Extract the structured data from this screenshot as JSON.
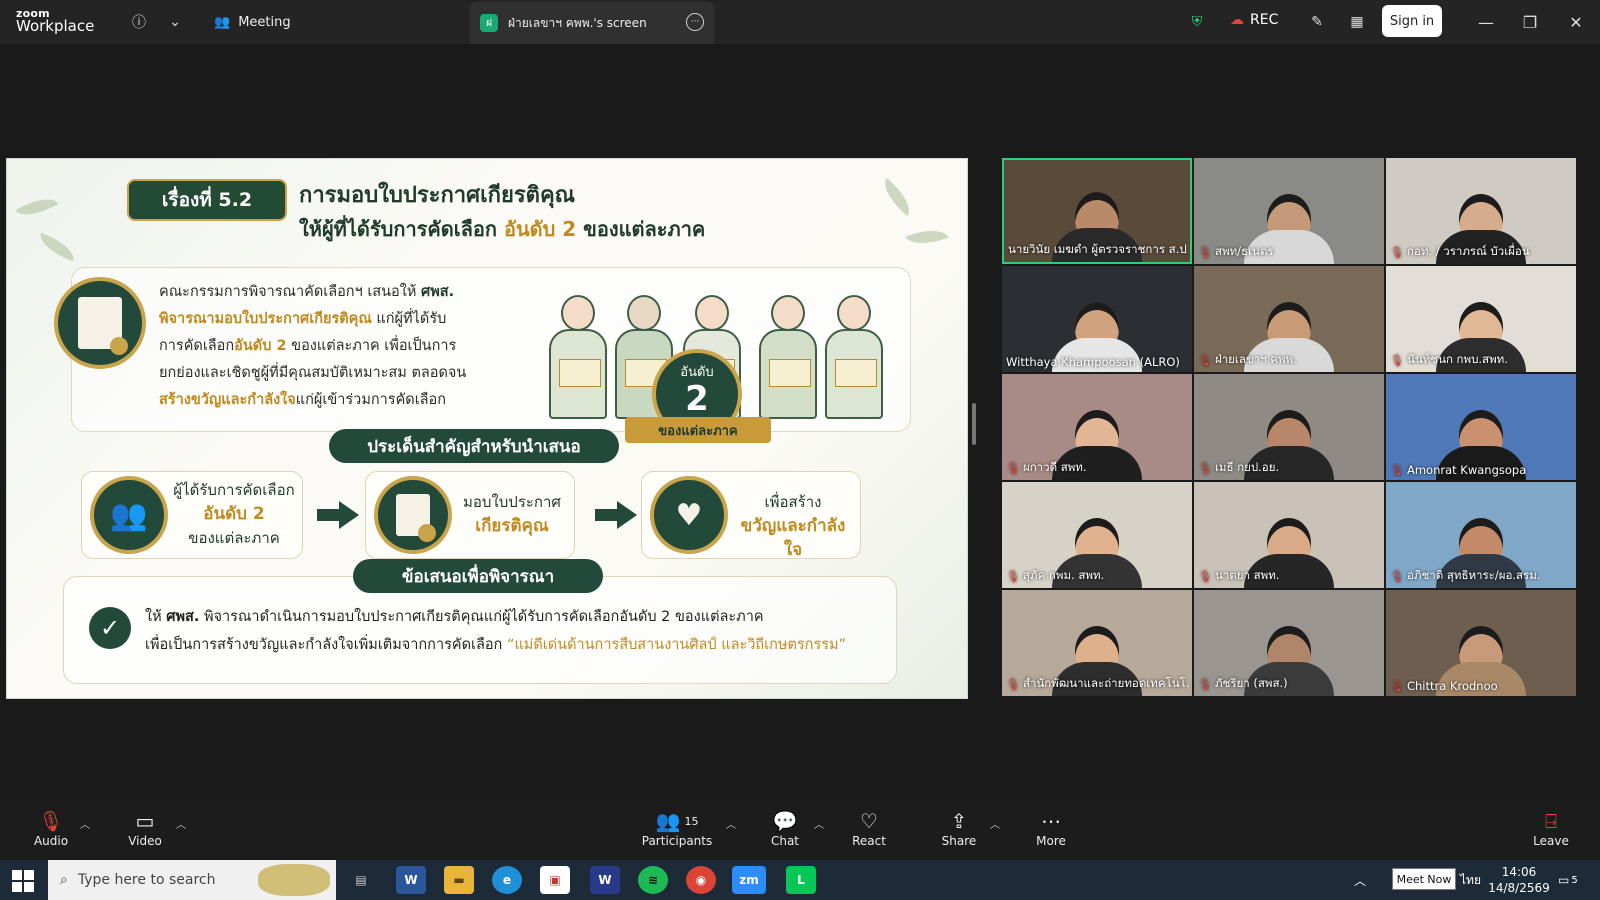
{
  "app": {
    "logo_top": "zoom",
    "logo_bottom": "Workplace"
  },
  "topbar": {
    "meeting_tab": "Meeting",
    "share_tab": "ฝ่ายเลขาฯ คพพ.'s screen",
    "share_badge": "ฝ",
    "rec_label": "REC",
    "signin_label": "Sign in"
  },
  "slide": {
    "topic_pill": "เรื่องที่ 5.2",
    "title_line1": "การมอบใบประกาศเกียรติคุณ",
    "title_line2_pre": "ให้ผู้ที่ได้รับการคัดเลือก ",
    "title_line2_hl": "อันดับ 2",
    "title_line2_post": " ของแต่ละภาค",
    "intro": {
      "l1_pre": "คณะกรรมการพิจารณาคัดเลือกฯ เสนอให้ ",
      "l1_b": "ศพส.",
      "l2_g": "พิจารณามอบใบประกาศเกียรติคุณ",
      "l2_post": " แก่ผู้ที่ได้รับ",
      "l3_pre": "การคัดเลือก",
      "l3_g": "อันดับ 2",
      "l3_post": " ของแต่ละภาค เพื่อเป็นการ",
      "l4": "ยกย่องและเชิดชูผู้ที่มีคุณสมบัติเหมาะสม ตลอดจน",
      "l5_g": "สร้างขวัญและกำลังใจ",
      "l5_post": "แก่ผู้เข้าร่วมการคัดเลือก"
    },
    "medal_top": "อันดับ",
    "medal_num": "2",
    "medal_ribbon": "ของแต่ละภาค",
    "key_points_title": "ประเด็นสำคัญสำหรับนำเสนอ",
    "cards": [
      {
        "l1": "ผู้ได้รับการคัดเลือก",
        "l2": "อันดับ 2",
        "l3": "ของแต่ละภาค",
        "icon": "people-icon"
      },
      {
        "l1": "มอบใบประกาศ",
        "l2": "เกียรติคุณ",
        "icon": "certificate-icon"
      },
      {
        "l1": "เพื่อสร้าง",
        "l2": "ขวัญและกำลังใจ",
        "icon": "heart-hands-icon"
      }
    ],
    "proposal_title": "ข้อเสนอเพื่อพิจารณา",
    "proposal": {
      "l1_pre": "ให้ ",
      "l1_b": "ศพส.",
      "l1_post": " พิจารณาดำเนินการมอบใบประกาศเกียรติคุณแก่ผู้ได้รับการคัดเลือกอันดับ 2 ของแต่ละภาค",
      "l2_pre": "เพื่อเป็นการสร้างขวัญและกำลังใจเพิ่มเติมจากการคัดเลือก ",
      "l2_g": "“แม่ดีเด่นด้านการสืบสานงานศิลป์ และวิถีเกษตรกรรม”"
    }
  },
  "participants_grid": [
    {
      "name": "นายวินัย เมฆดำ ผู้ตรวจราชการ ส.ป.",
      "muted": false,
      "active": true,
      "bg": "#5a4a3a",
      "skin": "#b88a6a",
      "shirt": "#2a2a2a"
    },
    {
      "name": "สพท/ธเนตร",
      "muted": true,
      "active": false,
      "bg": "#8a8a86",
      "skin": "#c49a7a",
      "shirt": "#d8d8d8"
    },
    {
      "name": "กอท. / วราภรณ์ บัวเผื่อน",
      "muted": true,
      "active": false,
      "bg": "#cfcac2",
      "skin": "#d6ad8c",
      "shirt": "#222"
    },
    {
      "name": "Witthaya Khampoosan (ALRO)",
      "muted": false,
      "active": false,
      "bg": "#2b2f33",
      "skin": "#d1a27e",
      "shirt": "#e6e6e6"
    },
    {
      "name": "ฝ่ายเลขาฯ คพพ.",
      "muted": true,
      "active": false,
      "bg": "#7a6a58",
      "skin": "#c99a76",
      "shirt": "#d9d9d9"
    },
    {
      "name": "นันท์ชนก กพบ.สพท.",
      "muted": true,
      "active": false,
      "bg": "#e2ddd6",
      "skin": "#e1b896",
      "shirt": "#2d2d2d"
    },
    {
      "name": "ผกาวดี สพท.",
      "muted": true,
      "active": false,
      "bg": "#a88a86",
      "skin": "#e2b594",
      "shirt": "#1f1f1f"
    },
    {
      "name": "เมธี กยป.อย.",
      "muted": true,
      "active": false,
      "bg": "#8f8b84",
      "skin": "#b8876a",
      "shirt": "#272727"
    },
    {
      "name": "Amonrat Kwangsopa",
      "muted": true,
      "active": false,
      "bg": "#4f78b8",
      "skin": "#c9916e",
      "shirt": "#1a1a1a"
    },
    {
      "name": "สุภัค กพม. สพท.",
      "muted": true,
      "active": false,
      "bg": "#d7d2c8",
      "skin": "#e0b28e",
      "shirt": "#333"
    },
    {
      "name": "นาตยา สพท.",
      "muted": true,
      "active": false,
      "bg": "#c8c2b8",
      "skin": "#d8aa88",
      "shirt": "#262626"
    },
    {
      "name": "อภิชาติ สุทธิหาระ/ผอ.สรม.",
      "muted": true,
      "active": false,
      "bg": "#7fa8c8",
      "skin": "#c28a66",
      "shirt": "#2f3a46"
    },
    {
      "name": "สำนักพัฒนาและถ่ายทอดเทคโนโ...",
      "muted": true,
      "active": false,
      "bg": "#b7a999",
      "skin": "#dfb08c",
      "shirt": "#2d2d2d"
    },
    {
      "name": "ภัชริยา (สพส.)",
      "muted": true,
      "active": false,
      "bg": "#9a9590",
      "skin": "#b0866a",
      "shirt": "#3b3b3b"
    },
    {
      "name": "Chittra Krodnoo",
      "muted": true,
      "active": false,
      "bg": "#6e5e50",
      "skin": "#c89a7a",
      "shirt": "#a98866"
    }
  ],
  "controls": {
    "audio": "Audio",
    "video": "Video",
    "participants": "Participants",
    "participants_count": "15",
    "chat": "Chat",
    "react": "React",
    "share": "Share",
    "more": "More",
    "leave": "Leave"
  },
  "taskbar": {
    "search_placeholder": "Type here to search",
    "meet_now": "Meet Now",
    "lang": "ไทย",
    "time": "14:06",
    "date": "14/8/2569",
    "notif_count": "5"
  }
}
